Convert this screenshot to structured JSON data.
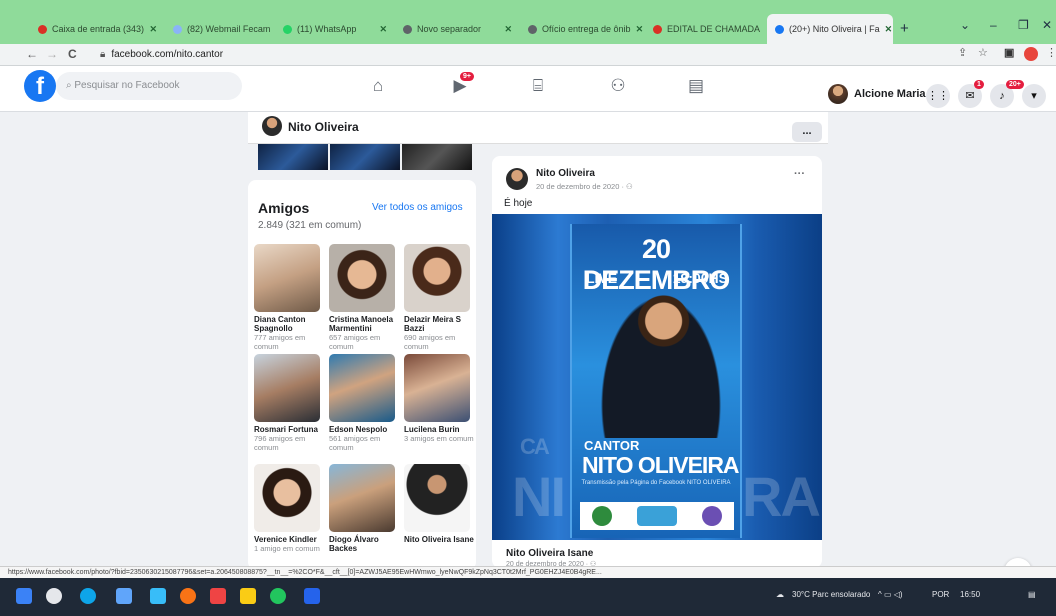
{
  "browser": {
    "tabs": [
      {
        "label": "Caixa de entrada (343)",
        "color": "#d93025"
      },
      {
        "label": "(82) Webmail Fecam",
        "color": "#8ab4f8"
      },
      {
        "label": "(11) WhatsApp",
        "color": "#25d366"
      },
      {
        "label": "Novo separador",
        "color": "#5f6368"
      },
      {
        "label": "Ofício entrega de ônib",
        "color": "#5f6368"
      },
      {
        "label": "EDITAL DE CHAMADA",
        "color": "#d93025"
      },
      {
        "label": "(20+) Nito Oliveira | Fa",
        "color": "#1877f2"
      }
    ],
    "new_tab": "+",
    "url": "facebook.com/nito.cantor",
    "status_url": "https://www.facebook.com/photo/?fbid=2350630215087796&set=a.206450808875?__tn__=%2CO*F&__cft__[0]=AZWJ5AE95EwHWmwo_lyeNwQF9kZpNq3CT0t2Mrf_PG0EHZJ4E0B4gRE...",
    "nav": {
      "back": "←",
      "forward": "→",
      "reload": "C"
    }
  },
  "fb": {
    "logo": "f",
    "search_placeholder": "Pesquisar no Facebook",
    "video_badge": "9+",
    "user_name": "Alcione Maria",
    "messenger_badge": "1",
    "notif_badge": "20+",
    "accent": "#1877f2"
  },
  "profile": {
    "name": "Nito Oliveira",
    "more": "..."
  },
  "friends": {
    "title": "Amigos",
    "see_all": "Ver todos os amigos",
    "count": "2.849 (321 em comum)",
    "items": [
      {
        "name": "Diana Canton Spagnollo",
        "mutual": "777 amigos em comum",
        "bg": "linear-gradient(160deg,#e9d8c7,#c4a083 50%,#6f5a48)"
      },
      {
        "name": "Cristina Manoela Marmentini",
        "mutual": "657 amigos em comum",
        "bg": "radial-gradient(circle at 50% 45%,#e6b894 0 14px,#3b2418 15px 24px,#b7b0a8 25px)"
      },
      {
        "name": "Delazir Meira S Bazzi",
        "mutual": "690 amigos em comum",
        "bg": "radial-gradient(circle at 50% 40%,#e2b08c 0 13px,#4a2a1a 14px 24px,#d9d2cb 25px)"
      },
      {
        "name": "Rosmari Fortuna",
        "mutual": "796 amigos em comum",
        "bg": "linear-gradient(160deg,#c7d3de,#a67d63 50%,#2a2e35)"
      },
      {
        "name": "Edson Nespolo",
        "mutual": "561 amigos em comum",
        "bg": "linear-gradient(160deg,#2f7ab0,#d0a380 45%,#185a8a)"
      },
      {
        "name": "Lucilena Burin",
        "mutual": "3 amigos em comum",
        "bg": "linear-gradient(160deg,#7a4a3a,#d9b294 45%,#3b4f73)"
      },
      {
        "name": "Verenice Kindler",
        "mutual": "1 amigo em comum",
        "bg": "radial-gradient(circle at 50% 42%,#e8bf9f 0 13px,#2a1a12 14px 24px,#f0ece8 25px)"
      },
      {
        "name": "Diogo Álvaro Backes",
        "mutual": "",
        "bg": "linear-gradient(160deg,#87b6d8,#caa07c 45%,#4a3a30)"
      },
      {
        "name": "Nito Oliveira Isane",
        "mutual": "",
        "bg": "radial-gradient(circle at 50% 30%,#c89672 0 9px,#222 10px 30px,#f5f5f5 31px)"
      }
    ]
  },
  "post": {
    "author": "Nito Oliveira",
    "date": "20 de dezembro de 2020 · ⚇",
    "menu": "···",
    "text": "É hoje",
    "poster": {
      "date": "20 DEZEMBRO",
      "live": "LIVE",
      "time": "19:00HS",
      "cantor": "CANTOR",
      "name": "NITO OLIVEIRA",
      "sub": "Transmissão pela Página do Facebook NITO OLIVEIRA",
      "ghost_left": "NI",
      "ghost_right": "RA",
      "ghost_top": "CA"
    },
    "footer_name": "Nito Oliveira Isane",
    "footer_date": "20 de dezembro de 2020 · ⚇"
  },
  "edit_icon": "✎",
  "taskbar": {
    "weather": "30°C Parc ensolarado",
    "lang": "POR",
    "time": "16:50"
  }
}
